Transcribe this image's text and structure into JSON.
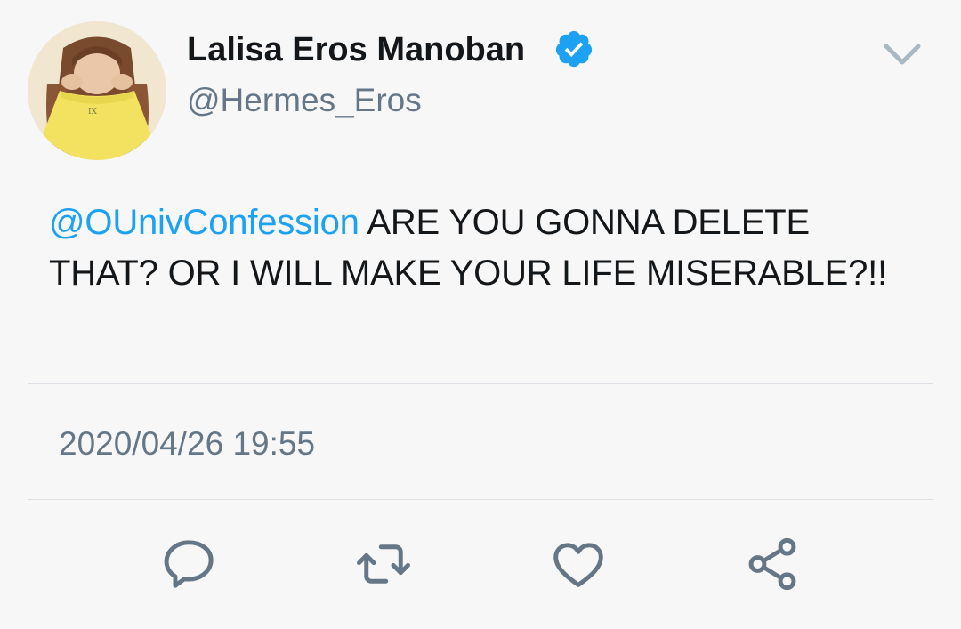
{
  "user": {
    "display_name": "Lalisa Eros Manoban",
    "handle": "@Hermes_Eros",
    "verified": true,
    "avatar_icon": "profile-photo"
  },
  "tweet": {
    "mention": "@OUnivConfession",
    "body": " ARE YOU GONNA DELETE THAT? OR I WILL MAKE YOUR LIFE MISERABLE?!!",
    "timestamp": "2020/04/26 19:55"
  },
  "menu": {
    "icon": "chevron-down-icon"
  },
  "actions": [
    {
      "name": "reply",
      "icon": "speech-bubble-icon"
    },
    {
      "name": "retweet",
      "icon": "retweet-icon"
    },
    {
      "name": "like",
      "icon": "heart-icon"
    },
    {
      "name": "share",
      "icon": "share-icon"
    }
  ],
  "colors": {
    "accent": "#1da1f2",
    "text": "#14171a",
    "secondary": "#657786",
    "background": "#f7f7f8"
  }
}
